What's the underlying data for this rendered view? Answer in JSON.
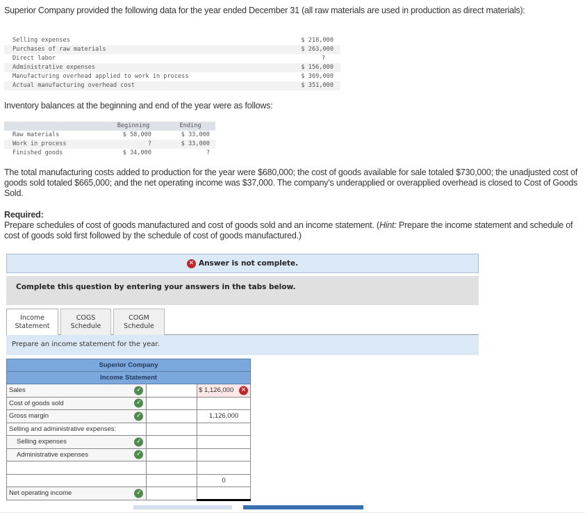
{
  "intro": "Superior Company provided the following data for the year ended December 31 (all raw materials are used in production as direct materials):",
  "data_table": [
    {
      "label": "Selling expenses",
      "value": "$ 218,000"
    },
    {
      "label": "Purchases of raw materials",
      "value": "$ 263,000"
    },
    {
      "label": "Direct labor",
      "value": "?"
    },
    {
      "label": "Administrative expenses",
      "value": "$ 156,000"
    },
    {
      "label": "Manufacturing overhead applied to work in process",
      "value": "$ 369,000"
    },
    {
      "label": "Actual manufacturing overhead cost",
      "value": "$ 351,000"
    }
  ],
  "inventory_intro": "Inventory balances at the beginning and end of the year were as follows:",
  "inventory_table": {
    "headers": [
      "",
      "Beginning",
      "Ending"
    ],
    "rows": [
      {
        "label": "Raw materials",
        "beginning": "$ 58,000",
        "ending": "$ 33,000"
      },
      {
        "label": "Work in process",
        "beginning": "?",
        "ending": "$ 33,000"
      },
      {
        "label": "Finished goods",
        "beginning": "$ 34,000",
        "ending": "?"
      }
    ]
  },
  "paragraph": "The total manufacturing costs added to production for the year were $680,000; the cost of goods available for sale totaled $730,000; the unadjusted cost of goods sold totaled $665,000; and the net operating income was $37,000. The company's underapplied or overapplied overhead is closed to Cost of Goods Sold.",
  "required": {
    "label": "Required:",
    "text_before_hint": "Prepare schedules of cost of goods manufactured and cost of goods sold and an income statement. (",
    "hint_label": "Hint:",
    "text_after_hint": " Prepare the income statement and schedule of cost of goods sold first followed by the schedule of cost of goods manufactured.)"
  },
  "status": {
    "icon": "x-circle-icon",
    "text": "Answer is not complete.",
    "color": "#c0272d"
  },
  "instructions": "Complete this question by entering your answers in the tabs below.",
  "tabs": [
    {
      "line1": "Income",
      "line2": "Statement",
      "active": true
    },
    {
      "line1": "COGS",
      "line2": "Schedule",
      "active": false
    },
    {
      "line1": "COGM",
      "line2": "Schedule",
      "active": false
    }
  ],
  "tab_instruction": "Prepare an income statement for the year.",
  "income_statement": {
    "company": "Superior Company",
    "title": "Income Statement",
    "rows": [
      {
        "label": "Sales",
        "check": true,
        "mid": "",
        "right": "$ 1,126,000",
        "right_status": "wrong"
      },
      {
        "label": "Cost of goods sold",
        "check": true,
        "mid": "",
        "right": ""
      },
      {
        "label": "Gross margin",
        "check": true,
        "mid": "",
        "right": "1,126,000"
      },
      {
        "label": "Selling and administrative expenses:",
        "check": false,
        "mid": "",
        "right": ""
      },
      {
        "label": "Selling expenses",
        "check": true,
        "mid": "",
        "right": ""
      },
      {
        "label": "Administrative expenses",
        "check": true,
        "mid": "",
        "right": ""
      },
      {
        "label": "",
        "check": false,
        "mid": "",
        "right": ""
      },
      {
        "label": "",
        "check": false,
        "mid": "",
        "right": "0"
      },
      {
        "label": "Net operating income",
        "check": true,
        "mid": "",
        "right": ""
      }
    ]
  },
  "colors": {
    "check": "#4f8a4f",
    "error": "#c0272d",
    "header_blue": "#7aa7dc",
    "info_blue": "#dbe9f7",
    "nav_next": "#3a6fb0"
  }
}
